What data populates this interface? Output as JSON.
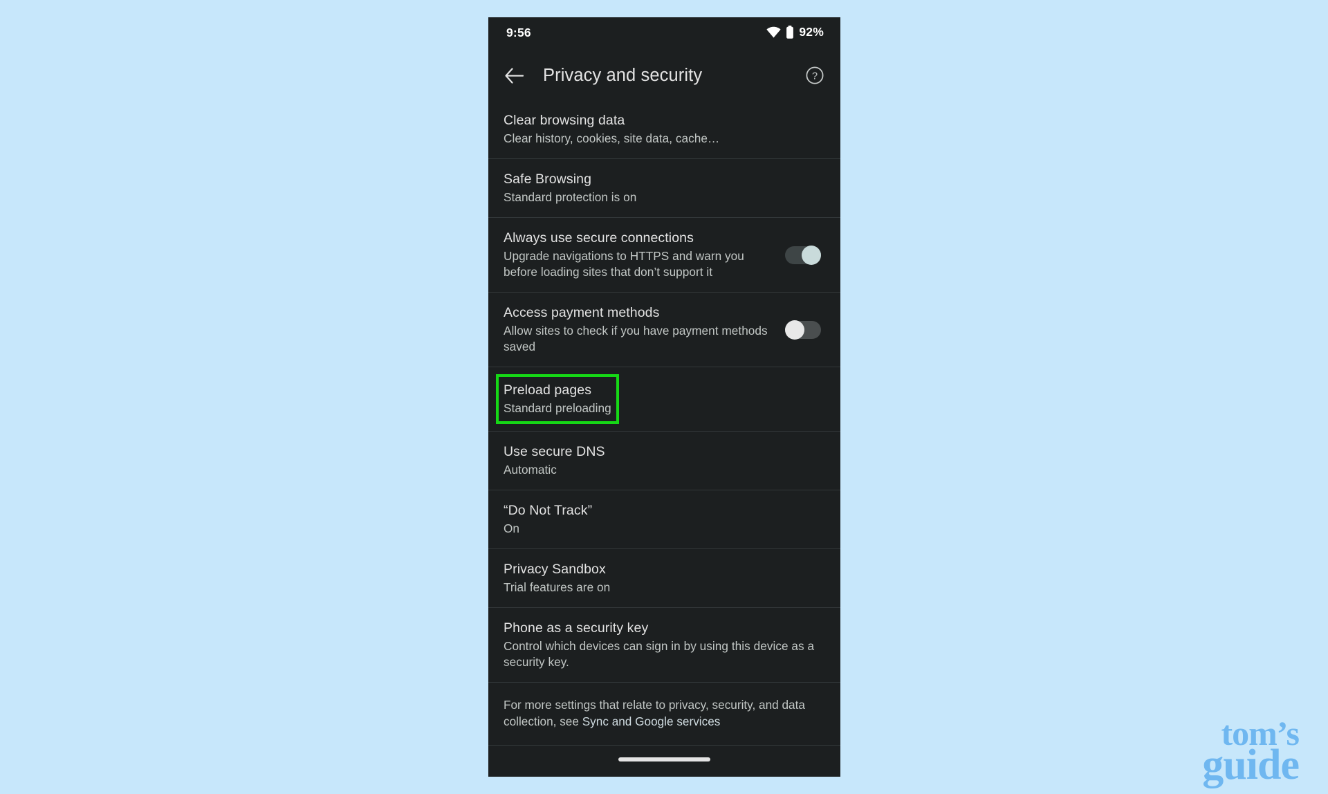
{
  "page": {
    "background_color": "#c7e7fb",
    "device_background": "#1c1f20"
  },
  "status_bar": {
    "time": "9:56",
    "battery_text": "92%",
    "wifi_icon": "wifi-icon",
    "battery_icon": "battery-icon"
  },
  "app_bar": {
    "back_icon": "back-arrow-icon",
    "title": "Privacy and security",
    "help_icon": "help-circle-icon"
  },
  "settings": {
    "items": [
      {
        "title": "Clear browsing data",
        "subtitle": "Clear history, cookies, site data, cache…",
        "control": "none",
        "highlighted": false
      },
      {
        "title": "Safe Browsing",
        "subtitle": "Standard protection is on",
        "control": "none",
        "highlighted": false
      },
      {
        "title": "Always use secure connections",
        "subtitle": "Upgrade navigations to HTTPS and warn you before loading sites that don’t support it",
        "control": "switch",
        "switch_state": "on",
        "highlighted": false
      },
      {
        "title": "Access payment methods",
        "subtitle": "Allow sites to check if you have payment methods saved",
        "control": "switch",
        "switch_state": "off",
        "highlighted": false
      },
      {
        "title": "Preload pages",
        "subtitle": "Standard preloading",
        "control": "none",
        "highlighted": true
      },
      {
        "title": "Use secure DNS",
        "subtitle": "Automatic",
        "control": "none",
        "highlighted": false
      },
      {
        "title": "“Do Not Track”",
        "subtitle": "On",
        "control": "none",
        "highlighted": false
      },
      {
        "title": "Privacy Sandbox",
        "subtitle": "Trial features are on",
        "control": "none",
        "highlighted": false
      },
      {
        "title": "Phone as a security key",
        "subtitle": "Control which devices can sign in by using this device as a security key.",
        "control": "none",
        "highlighted": false
      }
    ]
  },
  "footer": {
    "note_prefix": "For more settings that relate to privacy, security, and data collection, see ",
    "note_link": "Sync and Google services"
  },
  "nav_bar": {
    "pill": "home-gesture-pill"
  },
  "highlight": {
    "color": "#16d816",
    "target": "Preload pages"
  },
  "watermark": {
    "line1": "tom’s",
    "line2": "guide",
    "color": "#6fb7f0"
  }
}
